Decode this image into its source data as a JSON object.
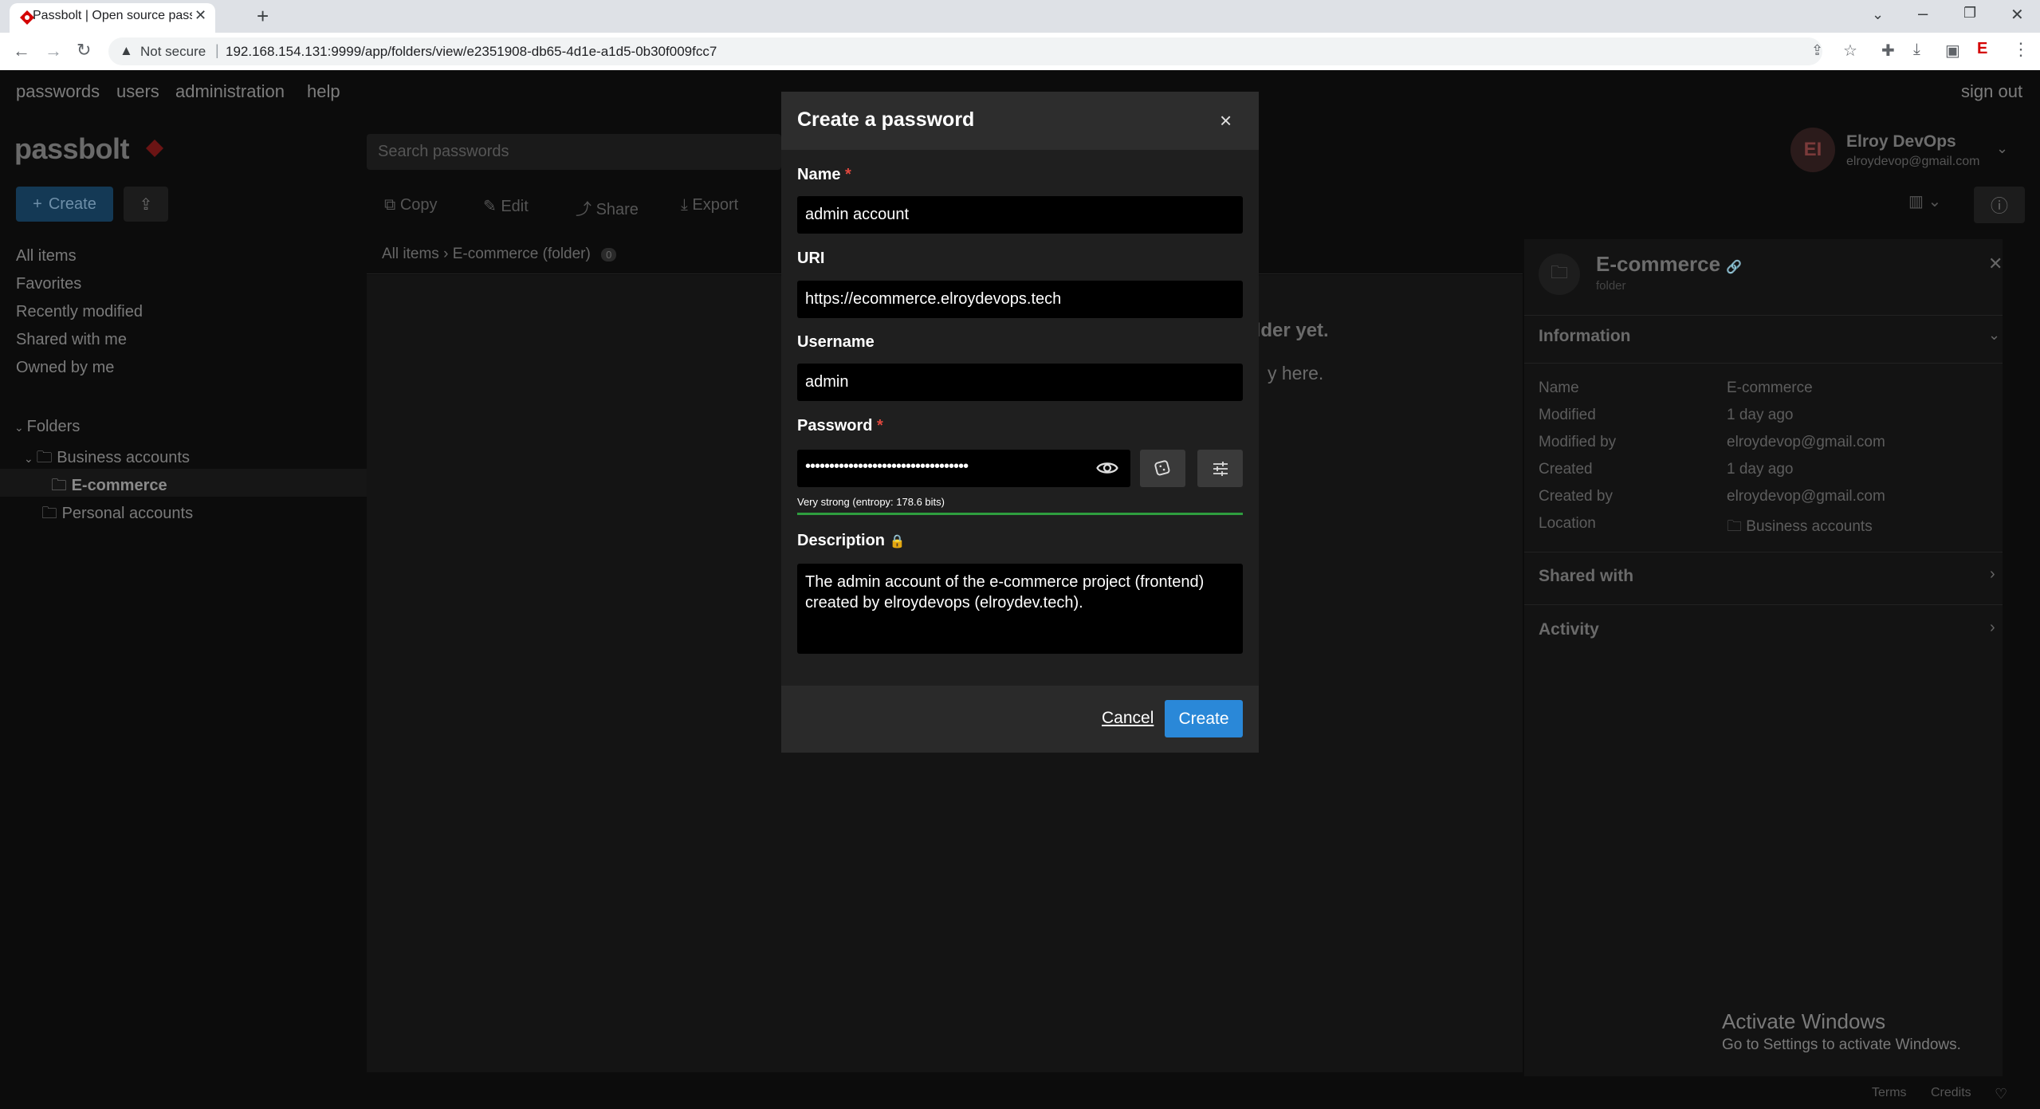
{
  "browser": {
    "tab_title": "Passbolt | Open source password manager",
    "not_secure": "Not secure",
    "url": "192.168.154.131:9999/app/folders/view/e2351908-db65-4d1e-a1d5-0b30f009fcc7"
  },
  "topnav": {
    "passwords": "passwords",
    "users": "users",
    "administration": "administration",
    "help": "help",
    "sign_out": "sign out"
  },
  "logo": "passbolt",
  "search": {
    "placeholder": "Search passwords"
  },
  "user": {
    "name": "Elroy DevOps",
    "email": "elroydevop@gmail.com",
    "initials": "EI"
  },
  "actions": {
    "create": "Create",
    "copy": "Copy",
    "edit": "Edit",
    "share": "Share",
    "export": "Export"
  },
  "filters": [
    "All items",
    "Favorites",
    "Recently modified",
    "Shared with me",
    "Owned by me"
  ],
  "folders": {
    "title": "Folders",
    "items": [
      "Business accounts",
      "E-commerce",
      "Personal accounts"
    ]
  },
  "breadcrumb": {
    "root": "All items",
    "current": "E-commerce (folder)",
    "count": "0"
  },
  "empty": {
    "line1": "older yet.",
    "line2": "y here."
  },
  "details": {
    "name": "E-commerce",
    "subtitle": "folder",
    "information_title": "Information",
    "rows": [
      {
        "label": "Name",
        "value": "E-commerce"
      },
      {
        "label": "Modified",
        "value": "1 day ago"
      },
      {
        "label": "Modified by",
        "value": "elroydevop@gmail.com"
      },
      {
        "label": "Created",
        "value": "1 day ago"
      },
      {
        "label": "Created by",
        "value": "elroydevop@gmail.com"
      },
      {
        "label": "Location",
        "value": "Business accounts"
      }
    ],
    "shared_with": "Shared with",
    "activity": "Activity"
  },
  "modal": {
    "title": "Create a password",
    "name_label": "Name",
    "name_value": "admin account",
    "uri_label": "URI",
    "uri_value": "https://ecommerce.elroydevops.tech",
    "username_label": "Username",
    "username_value": "admin",
    "password_label": "Password",
    "password_masked": "••••••••••••••••••••••••••••••••••",
    "strength_text": "Very strong (entropy: 178.6 bits)",
    "strength_fraction": 1.0,
    "description_label": "Description",
    "description_value": "The admin account of the e-commerce project (frontend) created by elroydevops (elroydev.tech).",
    "cancel": "Cancel",
    "create": "Create"
  },
  "windows": {
    "line1": "Activate Windows",
    "line2": "Go to Settings to activate Windows."
  },
  "footer": {
    "terms": "Terms",
    "credits": "Credits"
  },
  "colors": {
    "accent": "#2a88d8",
    "strength": "#2e9e3e",
    "required": "#e0483e",
    "brand": "#d40101"
  }
}
